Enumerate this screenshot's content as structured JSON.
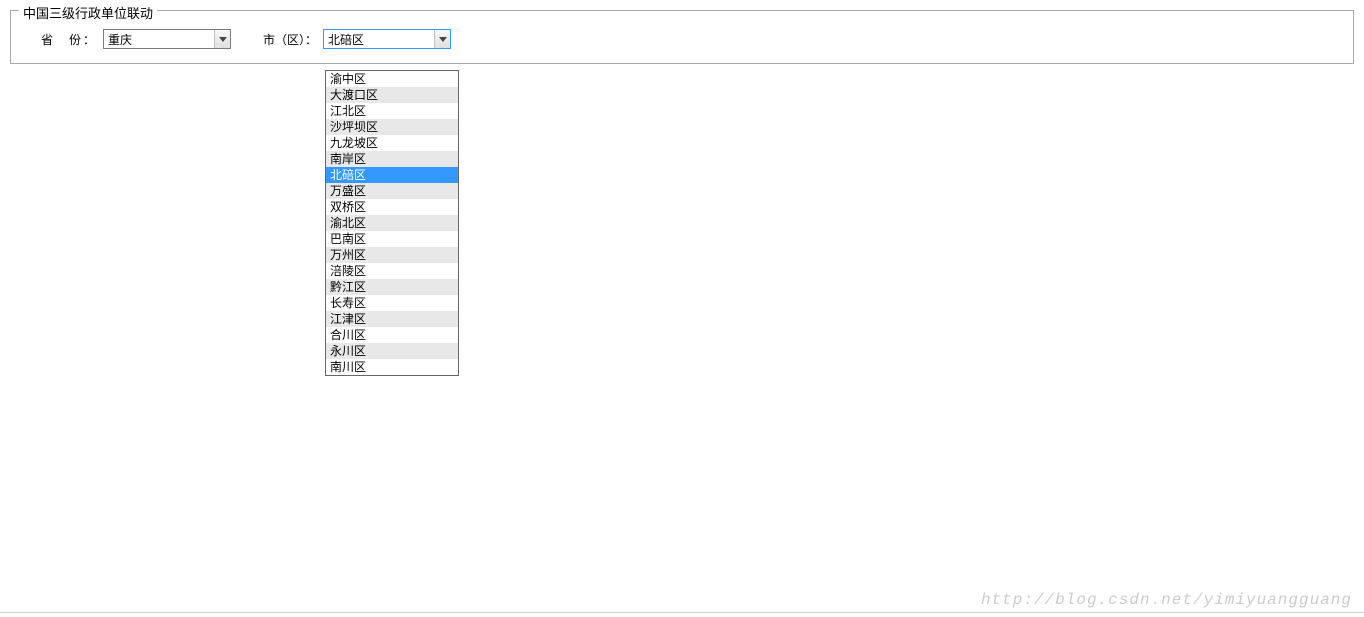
{
  "legend": "中国三级行政单位联动",
  "labels": {
    "province": "省　份：",
    "city": "市（区）："
  },
  "selects": {
    "province_value": "重庆",
    "city_value": "北碚区"
  },
  "dropdown_options": [
    {
      "label": "渝中区",
      "selected": false
    },
    {
      "label": "大渡口区",
      "selected": false
    },
    {
      "label": "江北区",
      "selected": false
    },
    {
      "label": "沙坪坝区",
      "selected": false
    },
    {
      "label": "九龙坡区",
      "selected": false
    },
    {
      "label": "南岸区",
      "selected": false
    },
    {
      "label": "北碚区",
      "selected": true
    },
    {
      "label": "万盛区",
      "selected": false
    },
    {
      "label": "双桥区",
      "selected": false
    },
    {
      "label": "渝北区",
      "selected": false
    },
    {
      "label": "巴南区",
      "selected": false
    },
    {
      "label": "万州区",
      "selected": false
    },
    {
      "label": "涪陵区",
      "selected": false
    },
    {
      "label": "黔江区",
      "selected": false
    },
    {
      "label": "长寿区",
      "selected": false
    },
    {
      "label": "江津区",
      "selected": false
    },
    {
      "label": "合川区",
      "selected": false
    },
    {
      "label": "永川区",
      "selected": false
    },
    {
      "label": "南川区",
      "selected": false
    }
  ],
  "watermark": "http://blog.csdn.net/yimiyuangguang"
}
